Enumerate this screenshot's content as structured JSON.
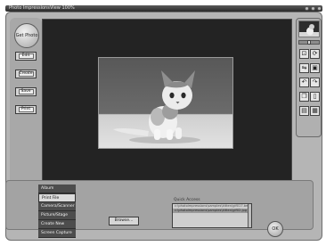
{
  "titlebar": {
    "app_title": "Photo Impressions",
    "view_label": "View 100%"
  },
  "left_buttons": {
    "get_photo": "Get Photo",
    "edit": "Edit",
    "create": "Create",
    "save": "Save",
    "print": "Print"
  },
  "nav": {
    "items": [
      {
        "label": "Album"
      },
      {
        "label": "Print File"
      },
      {
        "label": "Camera/Scanner"
      },
      {
        "label": "Picture/Stage"
      },
      {
        "label": "Create New"
      },
      {
        "label": "Screen Capture"
      }
    ],
    "active_index": 1
  },
  "browse_label": "Browse...",
  "quick_access": {
    "title": "Quick Access",
    "items": [
      "c:\\photoimpressions\\samples\\kitten\\gif017.bmp",
      "c:\\photoimpressions\\samples\\kitten\\gif02.jpg"
    ],
    "selected_index": 1
  },
  "ok_label": "OK",
  "tools": [
    {
      "icon": "crop-icon",
      "glyph": "⊡"
    },
    {
      "icon": "rotate-icon",
      "glyph": "⟳"
    },
    {
      "icon": "flip-icon",
      "glyph": "⇋"
    },
    {
      "icon": "mirror-icon",
      "glyph": "▣"
    },
    {
      "icon": "undo-icon",
      "glyph": "↶"
    },
    {
      "icon": "redo-icon",
      "glyph": "↷"
    },
    {
      "icon": "copy-icon",
      "glyph": "❐"
    },
    {
      "icon": "page-icon",
      "glyph": "▯"
    },
    {
      "icon": "layers-icon",
      "glyph": "▤"
    },
    {
      "icon": "grid-icon",
      "glyph": "▦"
    }
  ]
}
